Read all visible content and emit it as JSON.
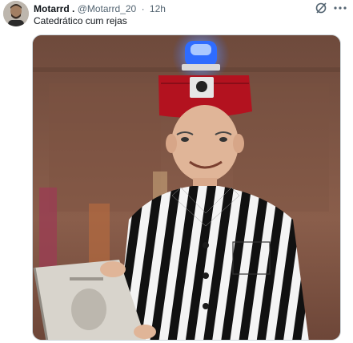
{
  "tweet": {
    "author_name": "Motarrd .",
    "author_handle": "@Motarrd_20",
    "separator": "·",
    "time": "12h",
    "text": "Catedrático cum rejas"
  },
  "icons": {
    "avatar": "user-avatar",
    "grok": "grok-icon",
    "more": "more-options-icon"
  },
  "media": {
    "description_tag": "photo-edited-academic-in-striped-prison-uniform"
  },
  "colors": {
    "text_primary": "#0f1419",
    "text_secondary": "#536471",
    "border": "#cfd9de",
    "fez_red": "#b3121f",
    "siren_blue": "#2e6cff"
  }
}
